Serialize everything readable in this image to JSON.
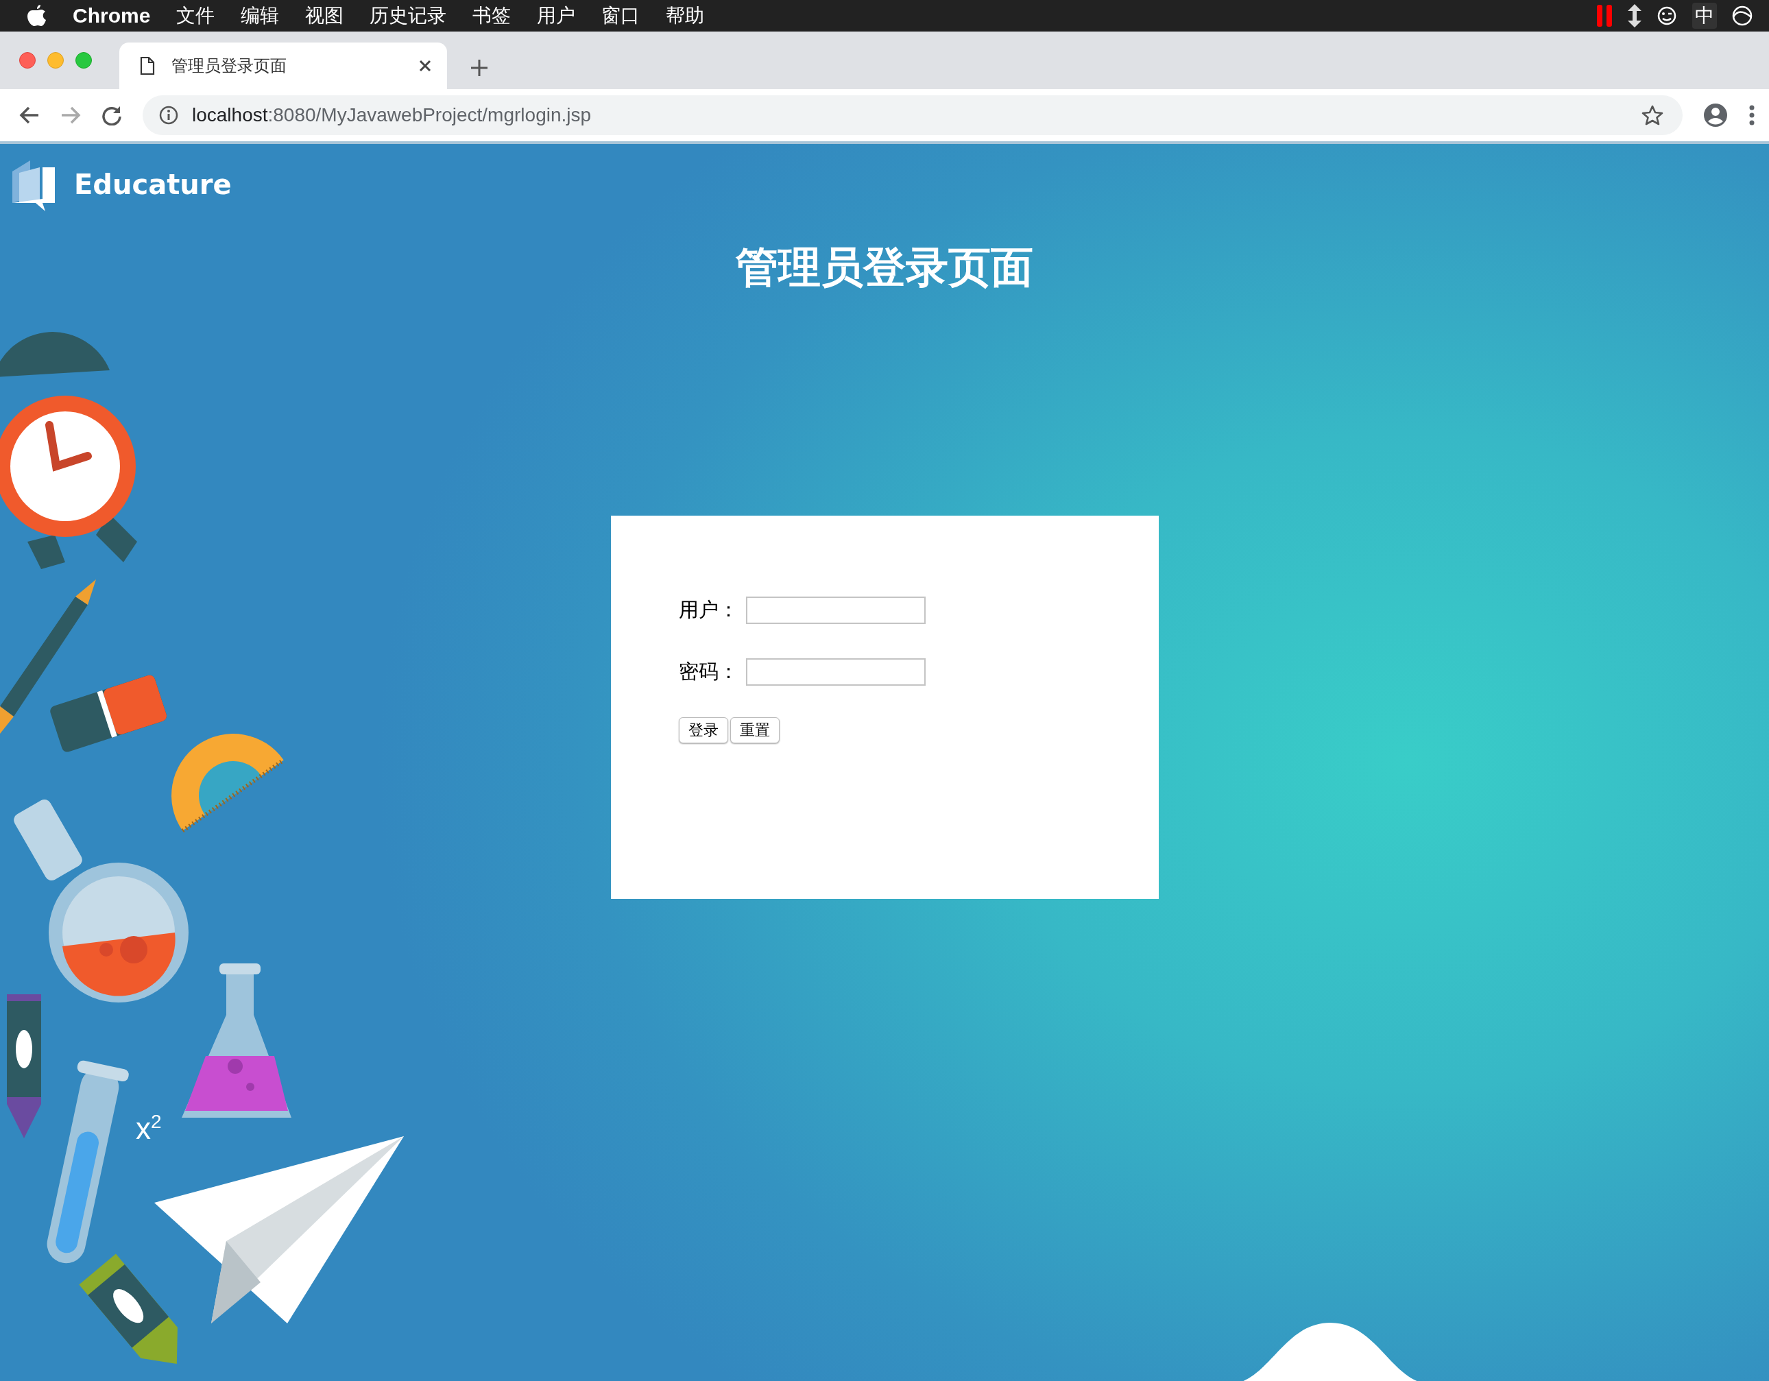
{
  "menu_bar": {
    "app": "Chrome",
    "menus": [
      "文件",
      "编辑",
      "视图",
      "历史记录",
      "书签",
      "用户",
      "窗口",
      "帮助"
    ],
    "input_method": "中"
  },
  "browser": {
    "tabs": [
      {
        "title": "管理员登录页面",
        "selected": true
      }
    ],
    "address": {
      "host": "localhost",
      "path": ":8080/MyJavawebProject/mgrlogin.jsp"
    }
  },
  "page": {
    "brand": "Educature",
    "heading": "管理员登录页面",
    "form": {
      "fields": [
        {
          "label": "用户："
        },
        {
          "label": "密码："
        }
      ],
      "buttons": [
        "登录",
        "重置"
      ]
    },
    "decor": {
      "formula": "x$^{2}$"
    }
  }
}
